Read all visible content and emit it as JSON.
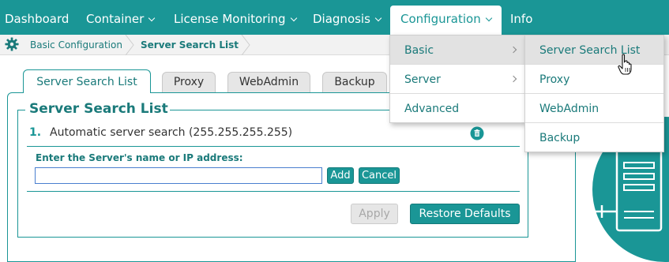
{
  "nav": {
    "items": [
      {
        "label": "Dashboard",
        "has_menu": false
      },
      {
        "label": "Container",
        "has_menu": true
      },
      {
        "label": "License Monitoring",
        "has_menu": true
      },
      {
        "label": "Diagnosis",
        "has_menu": true
      },
      {
        "label": "Configuration",
        "has_menu": true,
        "active": true
      },
      {
        "label": "Info",
        "has_menu": false
      }
    ]
  },
  "breadcrumb": {
    "icon": "gear-icon",
    "items": [
      {
        "label": "Basic Configuration"
      },
      {
        "label": "Server Search List",
        "current": true
      }
    ]
  },
  "tabs": [
    {
      "label": "Server Search List",
      "active": true
    },
    {
      "label": "Proxy"
    },
    {
      "label": "WebAdmin"
    },
    {
      "label": "Backup"
    }
  ],
  "panel": {
    "legend": "Server Search List",
    "entries": [
      {
        "number": "1.",
        "text": "Automatic server search (255.255.255.255)",
        "icon": "trash-icon"
      }
    ],
    "input_label": "Enter the Server's name or IP address:",
    "input_value": "",
    "add_label": "Add",
    "cancel_label": "Cancel",
    "apply_label": "Apply",
    "restore_label": "Restore Defaults"
  },
  "configuration_menu": {
    "items": [
      {
        "label": "Basic",
        "submenu": true,
        "highlighted": true
      },
      {
        "label": "Server",
        "submenu": true
      },
      {
        "label": "Advanced",
        "submenu": false
      }
    ]
  },
  "basic_submenu": {
    "items": [
      {
        "label": "Server Search List",
        "highlighted": true
      },
      {
        "label": "Proxy"
      },
      {
        "label": "WebAdmin"
      },
      {
        "label": "Backup"
      }
    ]
  },
  "colors": {
    "accent": "#1a9696",
    "accent_dark": "#1a7a7a",
    "highlight": "#e2e2e2"
  }
}
